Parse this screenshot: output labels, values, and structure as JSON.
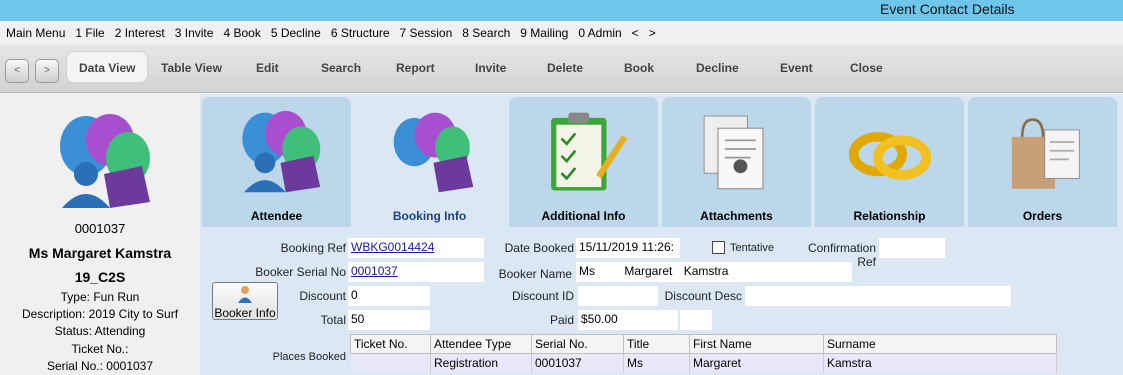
{
  "window": {
    "title": "Event Contact Details"
  },
  "menu": [
    "Main Menu",
    "1 File",
    "2 Interest",
    "3 Invite",
    "4 Book",
    "5 Decline",
    "6 Structure",
    "7 Session",
    "8 Search",
    "9 Mailing",
    "0 Admin",
    "<",
    ">"
  ],
  "toolbar": {
    "prev": "<",
    "next": ">",
    "items": [
      "Data View",
      "Table View",
      "Edit",
      "Search",
      "Report",
      "Invite",
      "Delete",
      "Book",
      "Decline",
      "Event",
      "Close"
    ]
  },
  "person": {
    "serial": "0001037",
    "name": "Ms Margaret Kamstra",
    "code": "19_C2S",
    "type": "Type: Fun Run",
    "description": "Description: 2019 City to Surf",
    "status": "Status: Attending",
    "ticket": "Ticket No.:",
    "serial_line": "Serial No.: 0001037"
  },
  "tabs": [
    "Attendee",
    "Booking Info",
    "Additional Info",
    "Attachments",
    "Relationship",
    "Orders"
  ],
  "form": {
    "booking_ref_label": "Booking Ref",
    "booking_ref": "WBKG0014424",
    "booker_serial_label": "Booker Serial No",
    "booker_serial": "0001037",
    "discount_label": "Discount",
    "discount": "0",
    "total_label": "Total",
    "total": "50",
    "date_booked_label": "Date Booked",
    "date_booked": "15/11/2019 11:26:",
    "tentative_label": "Tentative",
    "confirmation_label": "Confirmation Ref",
    "confirmation": "",
    "booker_name_label": "Booker Name",
    "booker_title": "Ms",
    "booker_first": "Margaret",
    "booker_last": "Kamstra",
    "discount_id_label": "Discount ID",
    "discount_id": "",
    "discount_desc_label": "Discount Desc",
    "discount_desc": "",
    "paid_label": "Paid",
    "paid": "$50.00",
    "booker_info": "Booker Info",
    "places_label": "Places Booked"
  },
  "places": {
    "columns": [
      "Ticket No.",
      "Attendee Type",
      "Serial No.",
      "Title",
      "First Name",
      "Surname"
    ],
    "rows": [
      [
        "",
        "Registration",
        "0001037",
        "Ms",
        "Margaret",
        "Kamstra"
      ]
    ]
  },
  "colors": {
    "titlebar": "#6ec6ea",
    "tab": "#bcd6ea",
    "panel": "#dbe8f4",
    "link": "#1a1aa8"
  }
}
